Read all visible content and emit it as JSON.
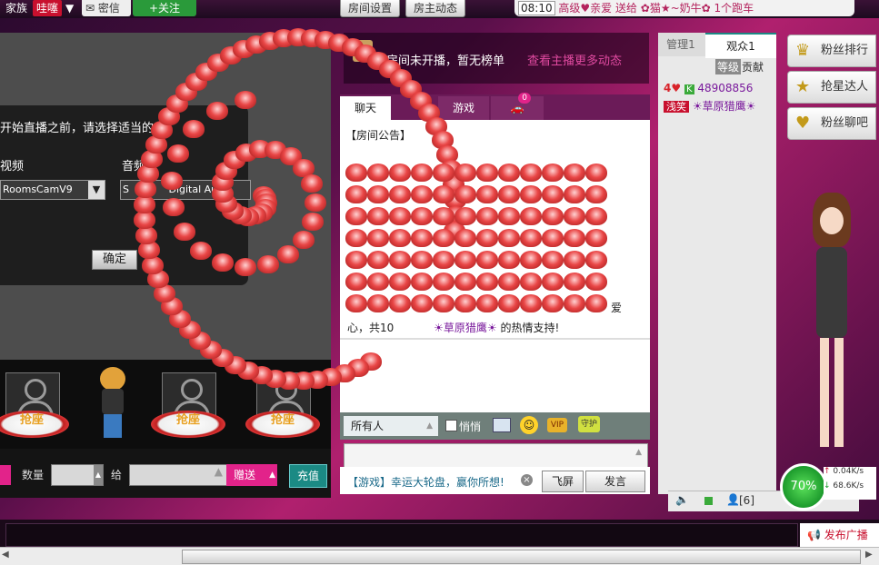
{
  "topbar": {
    "family_label": "家族",
    "family_badge": "哇噻",
    "mail_label": "密信",
    "follow_label": "+关注",
    "room_settings": "房间设置",
    "host_news": "房主动态",
    "time": "08:10",
    "ticker": "高级♥亲爱 送给 ✿猫★~奶牛✿ 1个跑车"
  },
  "stage": {
    "dialog_text": "开始直播之前，请选择适当的",
    "video_label": "视频",
    "audio_label": "音频",
    "video_device": "RoomsCamV9",
    "audio_device_prefix": "S",
    "audio_device": "Digital Au",
    "ok_button": "确定"
  },
  "seats": [
    {
      "label": "抢座"
    },
    {
      "label": "抢座"
    },
    {
      "label": "抢座"
    }
  ],
  "giftbar": {
    "quantity_label": "数量",
    "to_label": "给",
    "give_button": "赠送",
    "recharge_button": "充值"
  },
  "notice": {
    "text": "本房间未开播，暂无榜单",
    "link": "查看主播更多动态"
  },
  "chat": {
    "tabs": [
      "聊天",
      "游戏"
    ],
    "car_badge": "0",
    "announcement": "【房间公告】",
    "msg_tail": "爱",
    "msg_line2_prefix": "心，共10",
    "msg_user": "☀草原猎鹰☀",
    "msg_line2_suffix": "的热情支持!"
  },
  "toolbar": {
    "recipient": "所有人",
    "whisper_label": "悄悄",
    "vip_label": "VIP",
    "guard_label": "守护"
  },
  "input": {
    "game_promo": "【游戏】幸运大轮盘，赢你所想!",
    "fly_screen": "飞屏",
    "send": "发言"
  },
  "rpanel": {
    "tab_admin": "管理1",
    "tab_audience": "观众1",
    "sort_level": "等级",
    "sort_contrib": "贡献",
    "user_rank_num": "4",
    "user_k": "K",
    "user_id": "48908856",
    "user_tag": "浅笑",
    "user_name": "☀草原猎鹰☀",
    "count": "[6]"
  },
  "sidemenu": [
    {
      "label": "粉丝排行",
      "icon": "crown-icon"
    },
    {
      "label": "抢星达人",
      "icon": "star-icon"
    },
    {
      "label": "粉丝聊吧",
      "icon": "heart-icon"
    }
  ],
  "netmeter": {
    "percent": "70%",
    "up": "0.04K/s",
    "down": "68.6K/s"
  },
  "broadcast": {
    "label": "发布广播"
  },
  "colors": {
    "accent_pink": "#e2238a",
    "teal": "#1b8a84",
    "red": "#d8232a"
  }
}
